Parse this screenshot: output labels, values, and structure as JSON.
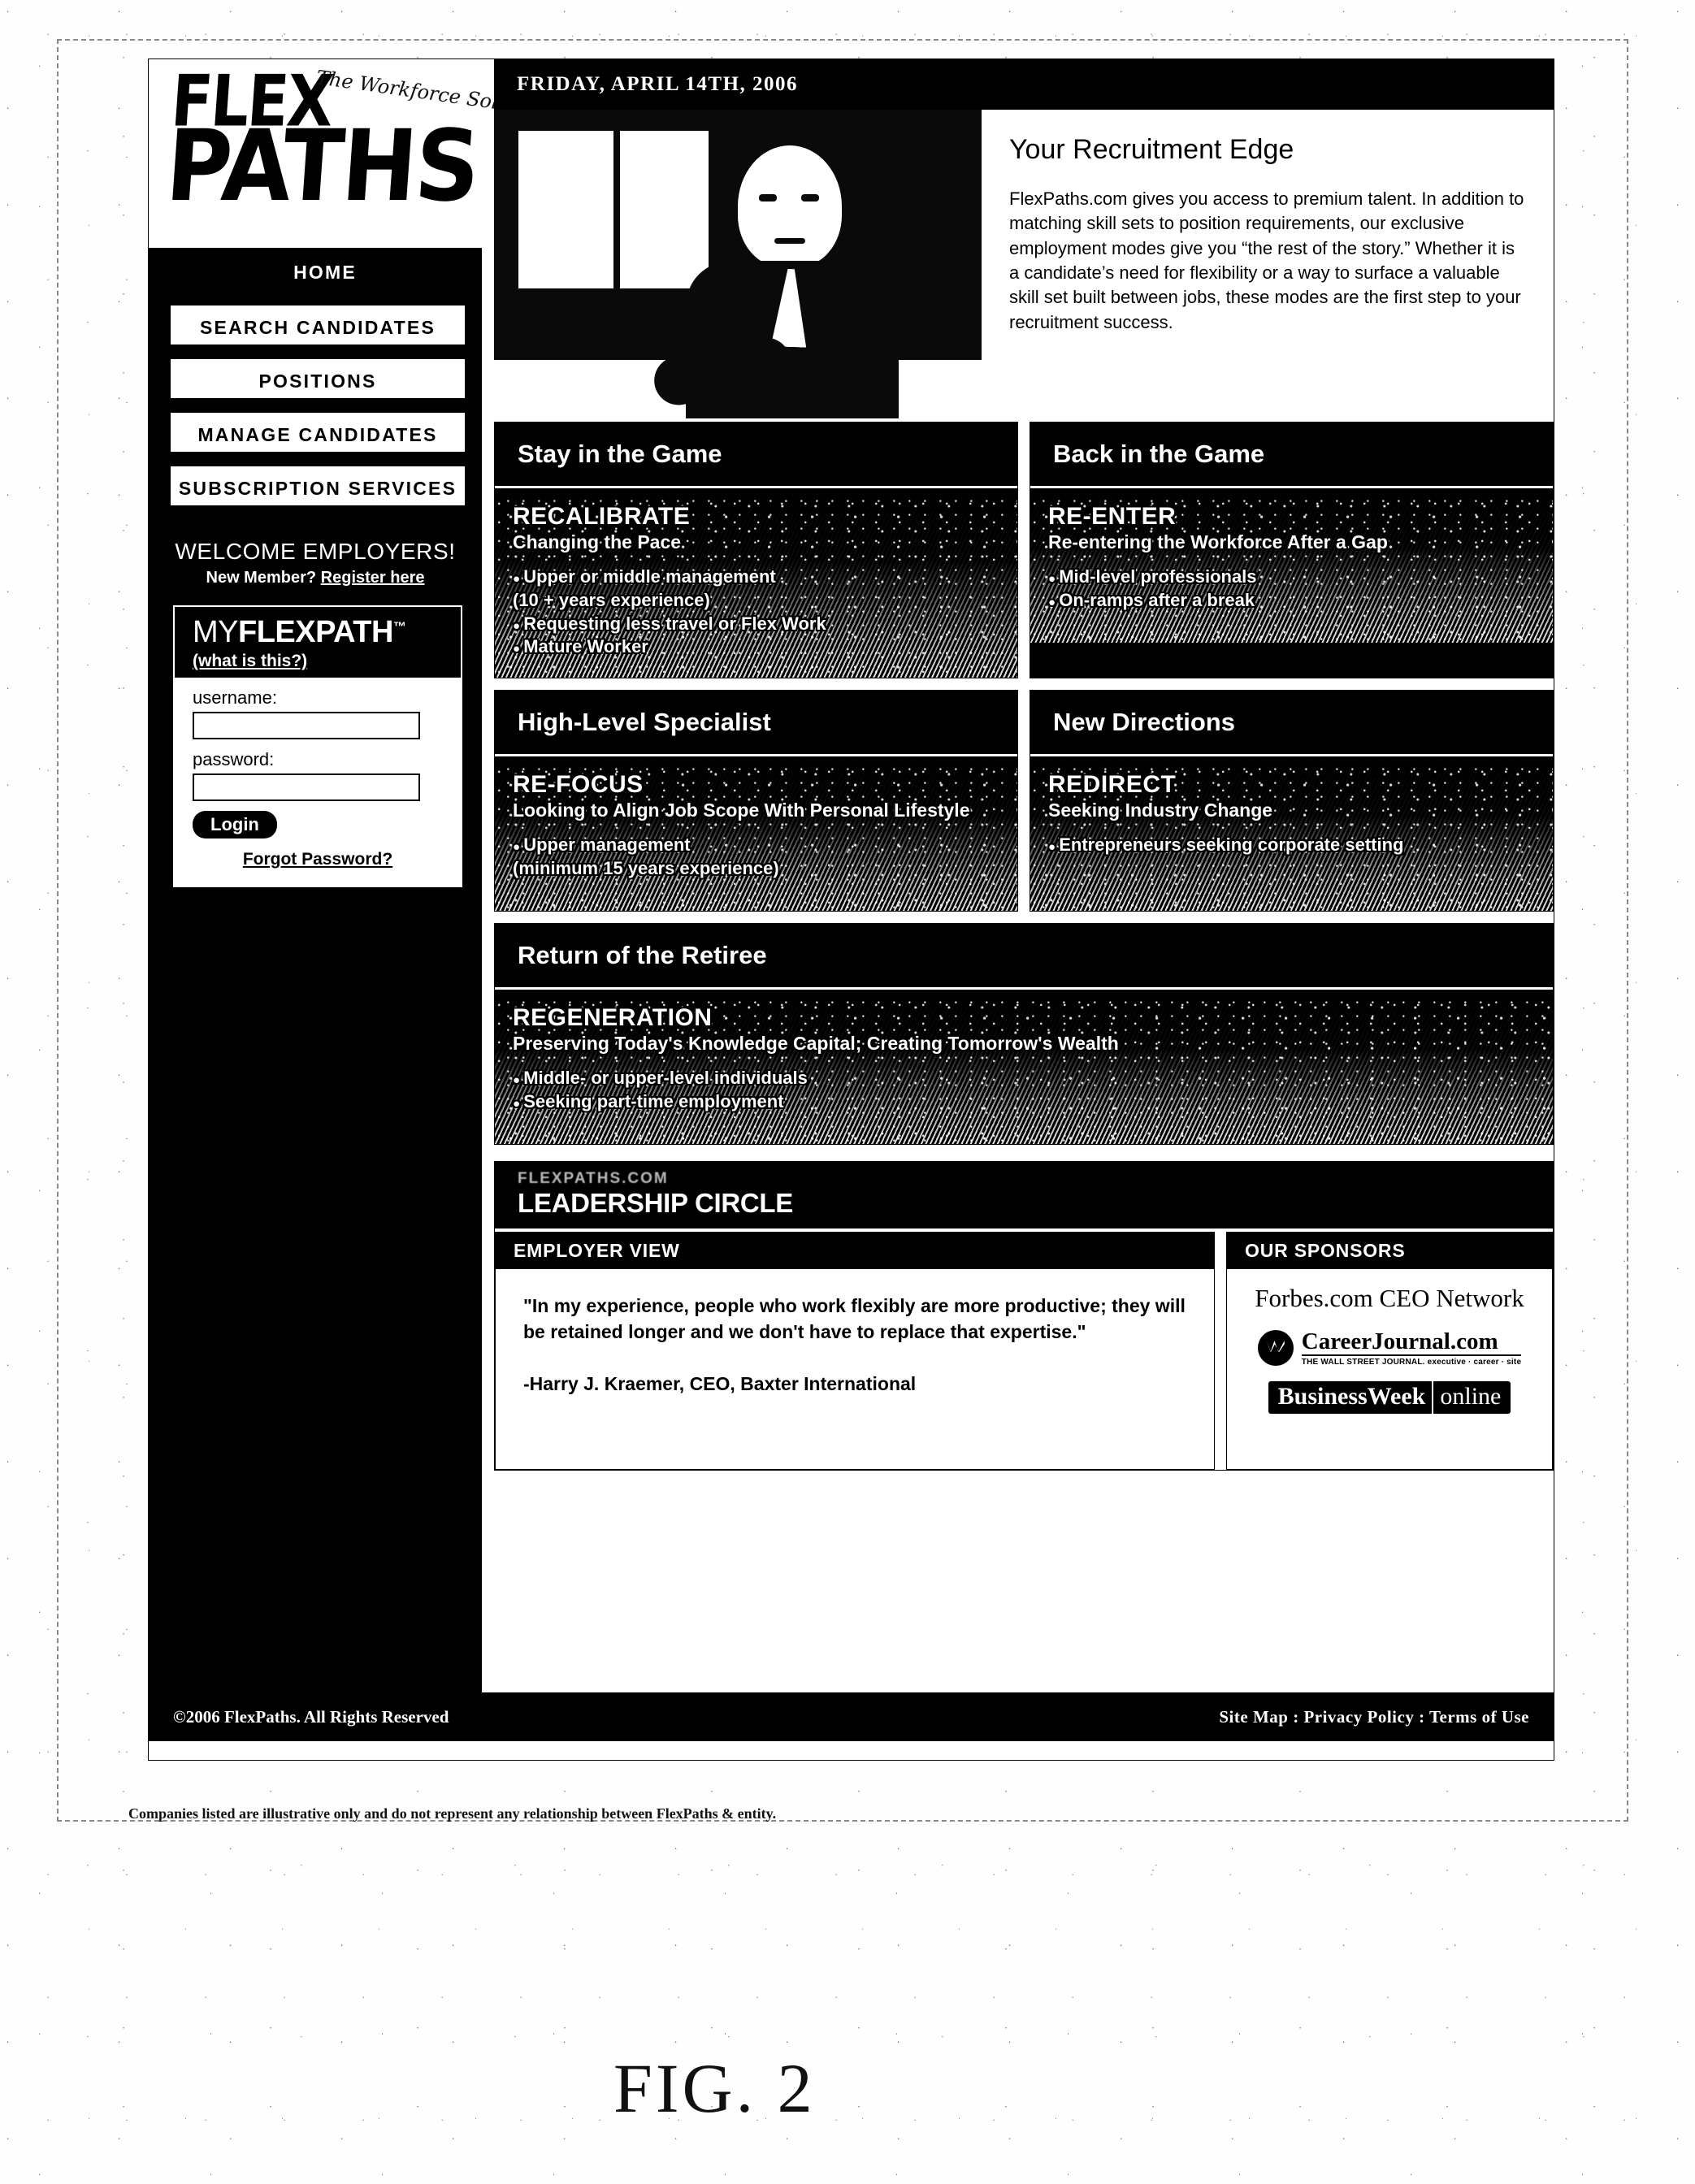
{
  "brand": {
    "logo_line1": "FLEX",
    "logo_line2": "PATHS",
    "tagline": "The Workforce Solution"
  },
  "sidebar": {
    "nav": [
      {
        "label": "HOME",
        "active": true
      },
      {
        "label": "SEARCH CANDIDATES",
        "active": false
      },
      {
        "label": "POSITIONS",
        "active": false
      },
      {
        "label": "MANAGE CANDIDATES",
        "active": false
      },
      {
        "label": "SUBSCRIPTION SERVICES",
        "active": false
      }
    ],
    "welcome_title": "WELCOME EMPLOYERS!",
    "welcome_sub_prefix": "New Member?",
    "welcome_sub_link": "Register here",
    "myflexpath": {
      "title_bold": "MY",
      "title_rest": "FLEXPATH",
      "trademark": "™",
      "what_is_this": "(what is this?)",
      "username_label": "username:",
      "username_value": "",
      "password_label": "password:",
      "password_value": "",
      "login_label": "Login",
      "forgot_label": "Forgot Password?"
    }
  },
  "header": {
    "date": "FRIDAY, APRIL 14TH, 2006"
  },
  "hero": {
    "title": "Your Recruitment Edge",
    "body": "FlexPaths.com gives you access to premium talent.  In addition to matching skill sets to position requirements, our exclusive employment modes give you “the rest of the story.” Whether it is a candidate’s need for flexibility or a way to surface a valuable skill set built between jobs, these modes are the first step to your recruitment success."
  },
  "modes": [
    {
      "panel_title": "Stay in the Game",
      "mode_name": "RECALIBRATE",
      "mode_sub": "Changing the Pace",
      "bullets": [
        "Upper or middle management",
        "(10 + years experience)",
        "Requesting less travel or Flex Work",
        "Mature Worker"
      ],
      "continuation_indexes": [
        1
      ]
    },
    {
      "panel_title": "Back in the Game",
      "mode_name": "RE-ENTER",
      "mode_sub": "Re-entering the Workforce After a Gap",
      "bullets": [
        "Mid-level professionals",
        "On-ramps after a break"
      ],
      "continuation_indexes": []
    },
    {
      "panel_title": "High-Level Specialist",
      "mode_name": "RE-FOCUS",
      "mode_sub": "Looking to Align Job Scope With Personal Lifestyle",
      "bullets": [
        "Upper management",
        "(minimum 15 years experience)"
      ],
      "continuation_indexes": [
        1
      ]
    },
    {
      "panel_title": "New Directions",
      "mode_name": "REDIRECT",
      "mode_sub": "Seeking Industry Change",
      "bullets": [
        "Entrepreneurs seeking corporate setting"
      ],
      "continuation_indexes": []
    },
    {
      "panel_title": "Return of the Retiree",
      "mode_name": "REGENERATION",
      "mode_sub": "Preserving Today's Knowledge Capital; Creating Tomorrow's Wealth",
      "bullets": [
        "Middle- or upper-level individuals",
        "Seeking part-time employment"
      ],
      "continuation_indexes": []
    }
  ],
  "leadership_circle": {
    "kicker": "FLEXPATHS.COM",
    "title": "LEADERSHIP CIRCLE",
    "employer_view_header": "EMPLOYER VIEW",
    "quote": "\"In my experience, people who work flexibly are more productive; they will be retained longer and we don't have to replace that expertise.\"",
    "attribution": "-Harry J. Kraemer, CEO, Baxter International",
    "sponsors_header": "OUR SPONSORS",
    "sponsors": [
      {
        "name": "Forbes.com CEO Network"
      },
      {
        "name": "CareerJournal.com",
        "sub": "THE WALL STREET JOURNAL. executive · career · site"
      },
      {
        "name_a": "BusinessWeek",
        "name_b": "online"
      }
    ]
  },
  "footer": {
    "copyright": "©2006 FlexPaths. All Rights Reserved",
    "site_map": "Site Map",
    "sep1": ":",
    "privacy": "Privacy Policy",
    "sep2": ":",
    "terms": "Terms of Use"
  },
  "page_notes": {
    "disclaimer": "Companies listed are illustrative only and do not represent any relationship between FlexPaths & entity.",
    "figure_label": "FIG. 2"
  }
}
